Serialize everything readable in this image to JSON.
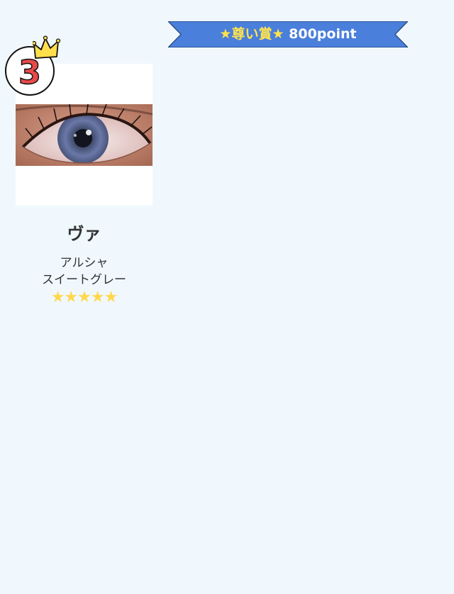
{
  "award_banner": {
    "award_label": "★尊い賞★",
    "points_label": "800point",
    "colors": {
      "ribbon": "#4a7fdc",
      "award_text": "#ffe34d",
      "points_text": "#ffffff"
    }
  },
  "entry": {
    "rank": "3",
    "rank_badge_icon": "crown-icon",
    "image_alt": "eye wearing gray-blue colored contact lens",
    "reviewer_name": "ヴァ",
    "product_brand": "アルシャ",
    "product_name": "スイートグレー",
    "rating_stars": "★★★★★",
    "rating": 5,
    "colors": {
      "rank_number": "#e84a4a",
      "crown": "#ffe04a",
      "stars": "#ffd84d"
    }
  }
}
